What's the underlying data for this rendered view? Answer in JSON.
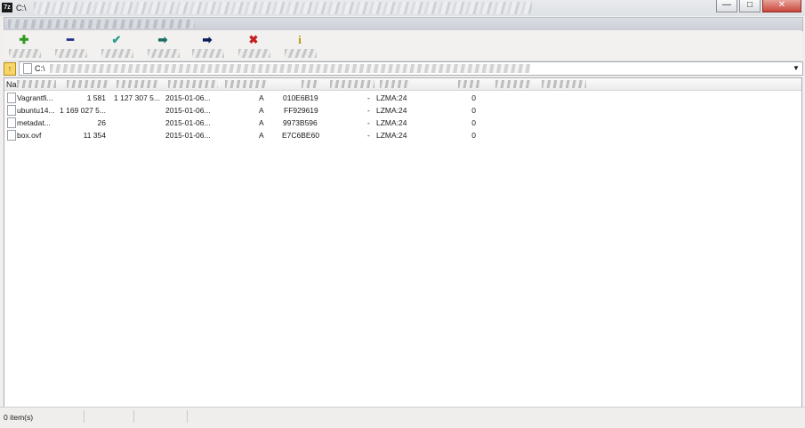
{
  "window": {
    "app_icon_text": "7z",
    "title": "C:\\"
  },
  "window_buttons": {
    "minimize": "—",
    "maximize": "□",
    "close": "✕"
  },
  "toolbar": {
    "buttons": [
      {
        "name": "add",
        "icon": "plus-icon",
        "glyph": "✚",
        "color": "#2e9a1e"
      },
      {
        "name": "extract",
        "icon": "minus-icon",
        "glyph": "━",
        "color": "#1f2b8a"
      },
      {
        "name": "test",
        "icon": "check-chevron-icon",
        "glyph": "✔",
        "color": "#2aa08a"
      },
      {
        "name": "copy",
        "icon": "arrow-right-icon",
        "glyph": "➡",
        "color": "#1d6e63"
      },
      {
        "name": "move",
        "icon": "arrow-right-dark-icon",
        "glyph": "➡",
        "color": "#0d1b5c"
      },
      {
        "name": "delete",
        "icon": "x-icon",
        "glyph": "✖",
        "color": "#c62020"
      },
      {
        "name": "info",
        "icon": "info-icon",
        "glyph": "i",
        "color": "#b89500"
      }
    ]
  },
  "address": {
    "path": "C:\\",
    "dropdown_glyph": "▼"
  },
  "list": {
    "header_name": "Na",
    "rows": [
      {
        "name": "Vagrantfi...",
        "size": "1 581",
        "packed": "1 127 307 5...",
        "modified": "2015-01-06...",
        "attr": "A",
        "crc": "010E6B19",
        "encrypted": "-",
        "method": "LZMA:24",
        "block": "0"
      },
      {
        "name": "ubuntu14...",
        "size": "1 169 027 5...",
        "packed": "",
        "modified": "2015-01-06...",
        "attr": "A",
        "crc": "FF929619",
        "encrypted": "-",
        "method": "LZMA:24",
        "block": "0"
      },
      {
        "name": "metadat...",
        "size": "26",
        "packed": "",
        "modified": "2015-01-06...",
        "attr": "A",
        "crc": "9973B596",
        "encrypted": "-",
        "method": "LZMA:24",
        "block": "0"
      },
      {
        "name": "box.ovf",
        "size": "11 354",
        "packed": "",
        "modified": "2015-01-06...",
        "attr": "A",
        "crc": "E7C6BE60",
        "encrypted": "-",
        "method": "LZMA:24",
        "block": "0"
      }
    ]
  },
  "status": {
    "text": "0 item(s)"
  }
}
